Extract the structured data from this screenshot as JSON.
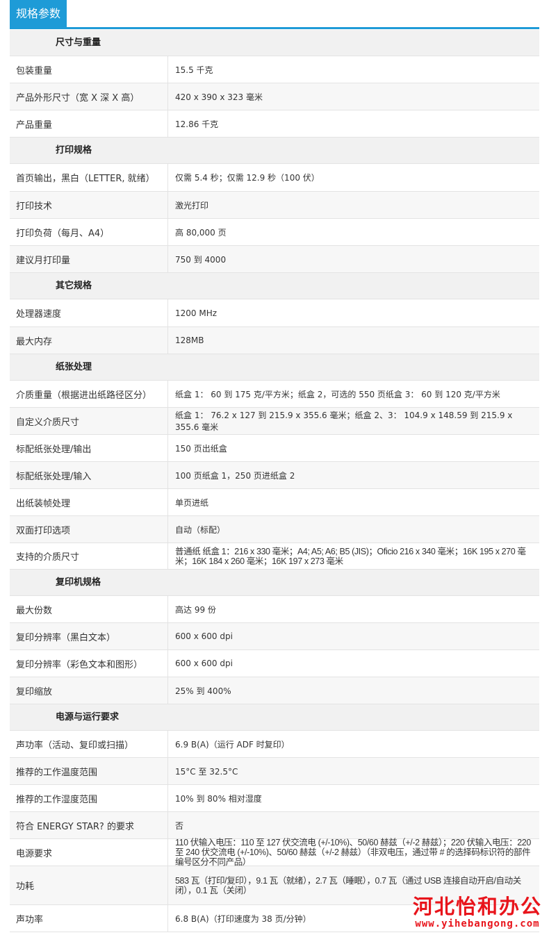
{
  "tab_title": "规格参数",
  "sections": [
    {
      "title": "尺寸与重量",
      "rows": [
        {
          "k": "包装重量",
          "v": "15.5 千克"
        },
        {
          "k": "产品外形尺寸（宽 X 深 X 高）",
          "v": "420 x 390 x 323 毫米"
        },
        {
          "k": "产品重量",
          "v": "12.86 千克"
        }
      ]
    },
    {
      "title": "打印规格",
      "rows": [
        {
          "k": "首页输出，黑白（LETTER, 就绪）",
          "v": "仅需 5.4 秒；仅需 12.9 秒（100 伏）"
        },
        {
          "k": "打印技术",
          "v": "激光打印"
        },
        {
          "k": "打印负荷（每月、A4）",
          "v": "高 80,000 页"
        },
        {
          "k": "建议月打印量",
          "v": "750 到 4000"
        }
      ]
    },
    {
      "title": "其它规格",
      "rows": [
        {
          "k": "处理器速度",
          "v": "1200 MHz"
        },
        {
          "k": "最大内存",
          "v": "128MB"
        }
      ]
    },
    {
      "title": "纸张处理",
      "rows": [
        {
          "k": "介质重量（根据进出纸路径区分）",
          "v": "纸盒 1： 60 到 175 克/平方米；纸盒 2，可选的 550 页纸盒 3： 60 到 120 克/平方米"
        },
        {
          "k": "自定义介质尺寸",
          "v": "纸盒 1： 76.2 x 127 到 215.9 x 355.6 毫米；纸盒 2、3： 104.9 x 148.59 到 215.9 x 355.6 毫米"
        },
        {
          "k": "标配纸张处理/输出",
          "v": "150 页出纸盒"
        },
        {
          "k": "标配纸张处理/输入",
          "v": "100 页纸盒 1，250 页进纸盒 2"
        },
        {
          "k": "出纸装帧处理",
          "v": "单页进纸"
        },
        {
          "k": "双面打印选项",
          "v": "自动（标配）"
        },
        {
          "k": "支持的介质尺寸",
          "v": "普通纸 纸盒 1：216 x 330 毫米；A4; A5; A6; B5 (JIS)；Oficio 216 x 340 毫米；16K 195 x 270 毫米；16K 184 x 260 毫米；16K 197 x 273 毫米"
        }
      ]
    },
    {
      "title": "复印机规格",
      "rows": [
        {
          "k": "最大份数",
          "v": "高达 99 份"
        },
        {
          "k": "复印分辨率（黑白文本）",
          "v": "600 x 600 dpi"
        },
        {
          "k": "复印分辨率（彩色文本和图形）",
          "v": "600 x 600 dpi"
        },
        {
          "k": "复印缩放",
          "v": "25% 到 400%"
        }
      ]
    },
    {
      "title": "电源与运行要求",
      "rows": [
        {
          "k": "声功率（活动、复印或扫描）",
          "v": "6.9 B(A)（运行 ADF 时复印）"
        },
        {
          "k": "推荐的工作温度范围",
          "v": "15°C 至 32.5°C"
        },
        {
          "k": "推荐的工作湿度范围",
          "v": "10% 到 80% 相对湿度"
        },
        {
          "k": "符合 ENERGY STAR? 的要求",
          "v": "否"
        },
        {
          "k": "电源要求",
          "v": "110 伏输入电压：110 至 127 伏交流电 (+/-10%)、50/60 赫兹（+/-2 赫兹）；220 伏输入电压：220 至 240 伏交流电 (+/-10%)、50/60 赫兹（+/-2 赫兹）（非双电压，通过带 # 的选择码标识符的部件编号区分不同产品）"
        },
        {
          "k": "功耗",
          "v": "583 瓦（打印/复印），9.1 瓦（就绪），2.7 瓦（睡眠），0.7 瓦（通过 USB 连接自动开启/自动关闭），0.1 瓦（关闭）"
        },
        {
          "k": "声功率",
          "v": "6.8 B(A)（打印速度为 38 页/分钟）"
        }
      ]
    }
  ],
  "watermark": {
    "title": "河北怡和办公",
    "url": "www.yihebangong.com"
  }
}
